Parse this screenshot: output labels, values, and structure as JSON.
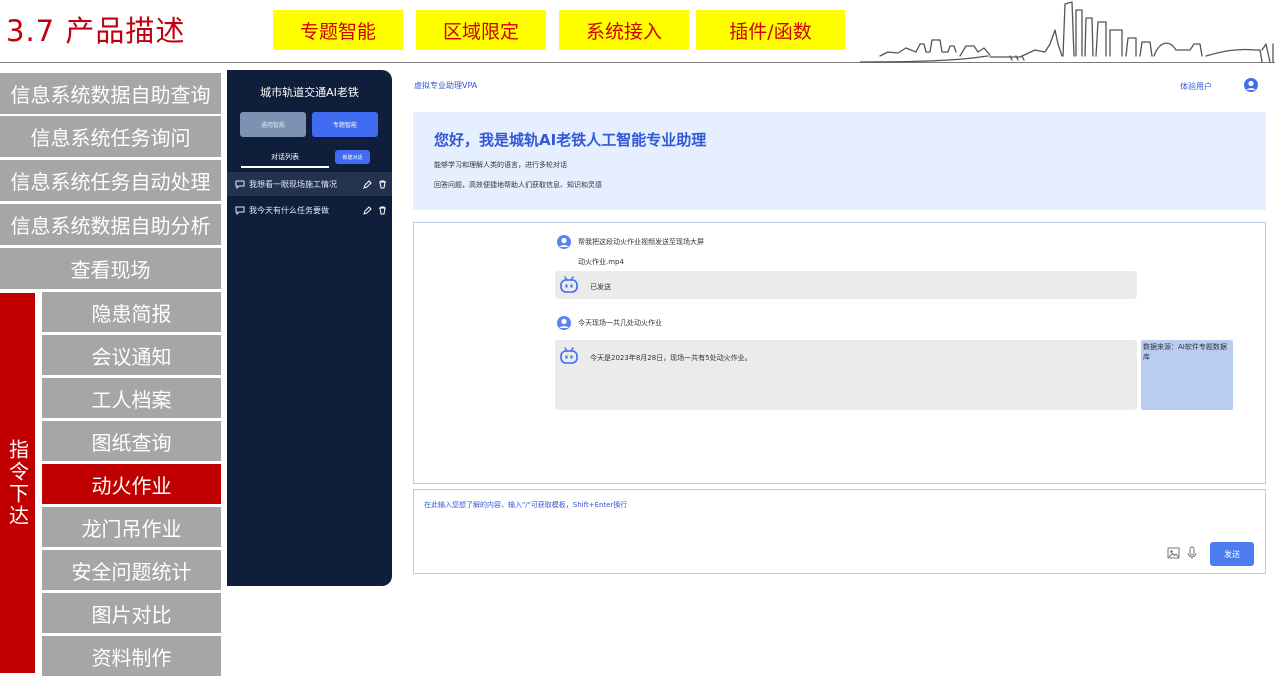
{
  "slide": {
    "title": "3.7 产品描述",
    "tabs": [
      "专题智能",
      "区域限定",
      "系统接入",
      "插件/函数"
    ]
  },
  "menu": {
    "items": [
      "信息系统数据自助查询",
      "信息系统任务询问",
      "信息系统任务自动处理",
      "信息系统数据自助分析",
      "查看现场"
    ],
    "command_label": "指令下达",
    "sub_items": [
      "隐患简报",
      "会议通知",
      "工人档案",
      "图纸查询",
      "动火作业",
      "龙门吊作业",
      "安全问题统计",
      "图片对比",
      "资料制作"
    ],
    "active": "动火作业"
  },
  "sidebar": {
    "title": "城市轨道交通AI老铁",
    "buttons": [
      "通用智能",
      "专题智能"
    ],
    "list_tab": "对话列表",
    "new_chat": "新建对话",
    "chats": [
      "我想看一眼现场施工情况",
      "我今天有什么任务要做"
    ]
  },
  "app": {
    "name": "虚拟专业助理VPA",
    "user": "体验用户",
    "welcome": {
      "heading": "您好，我是城轨AI老铁人工智能专业助理",
      "line1": "能够学习和理解人类的语言，进行多轮对话",
      "line2": "回答问题，高效便捷地帮助人们获取信息、知识和灵感"
    },
    "conversation": {
      "q1": "帮我把这段动火作业视频发送至现场大屏",
      "attachment": "动火作业.mp4",
      "a1": "已发送",
      "q2": "今天现场一共几处动火作业",
      "a2": "今天是2023年8月28日，现场一共有5处动火作业。",
      "source": "数据来源：AI软件专题数据库"
    },
    "composer": {
      "placeholder": "在此输入您想了解的内容，输入\"/\"可获取模板，Shift+Enter换行",
      "send": "发送"
    }
  },
  "colors": {
    "accent_red": "#c00000",
    "tab_yellow": "#ffff00",
    "menu_grey": "#a6a6a6",
    "sidebar_navy": "#0f1f3b",
    "brand_blue": "#3358d6"
  }
}
